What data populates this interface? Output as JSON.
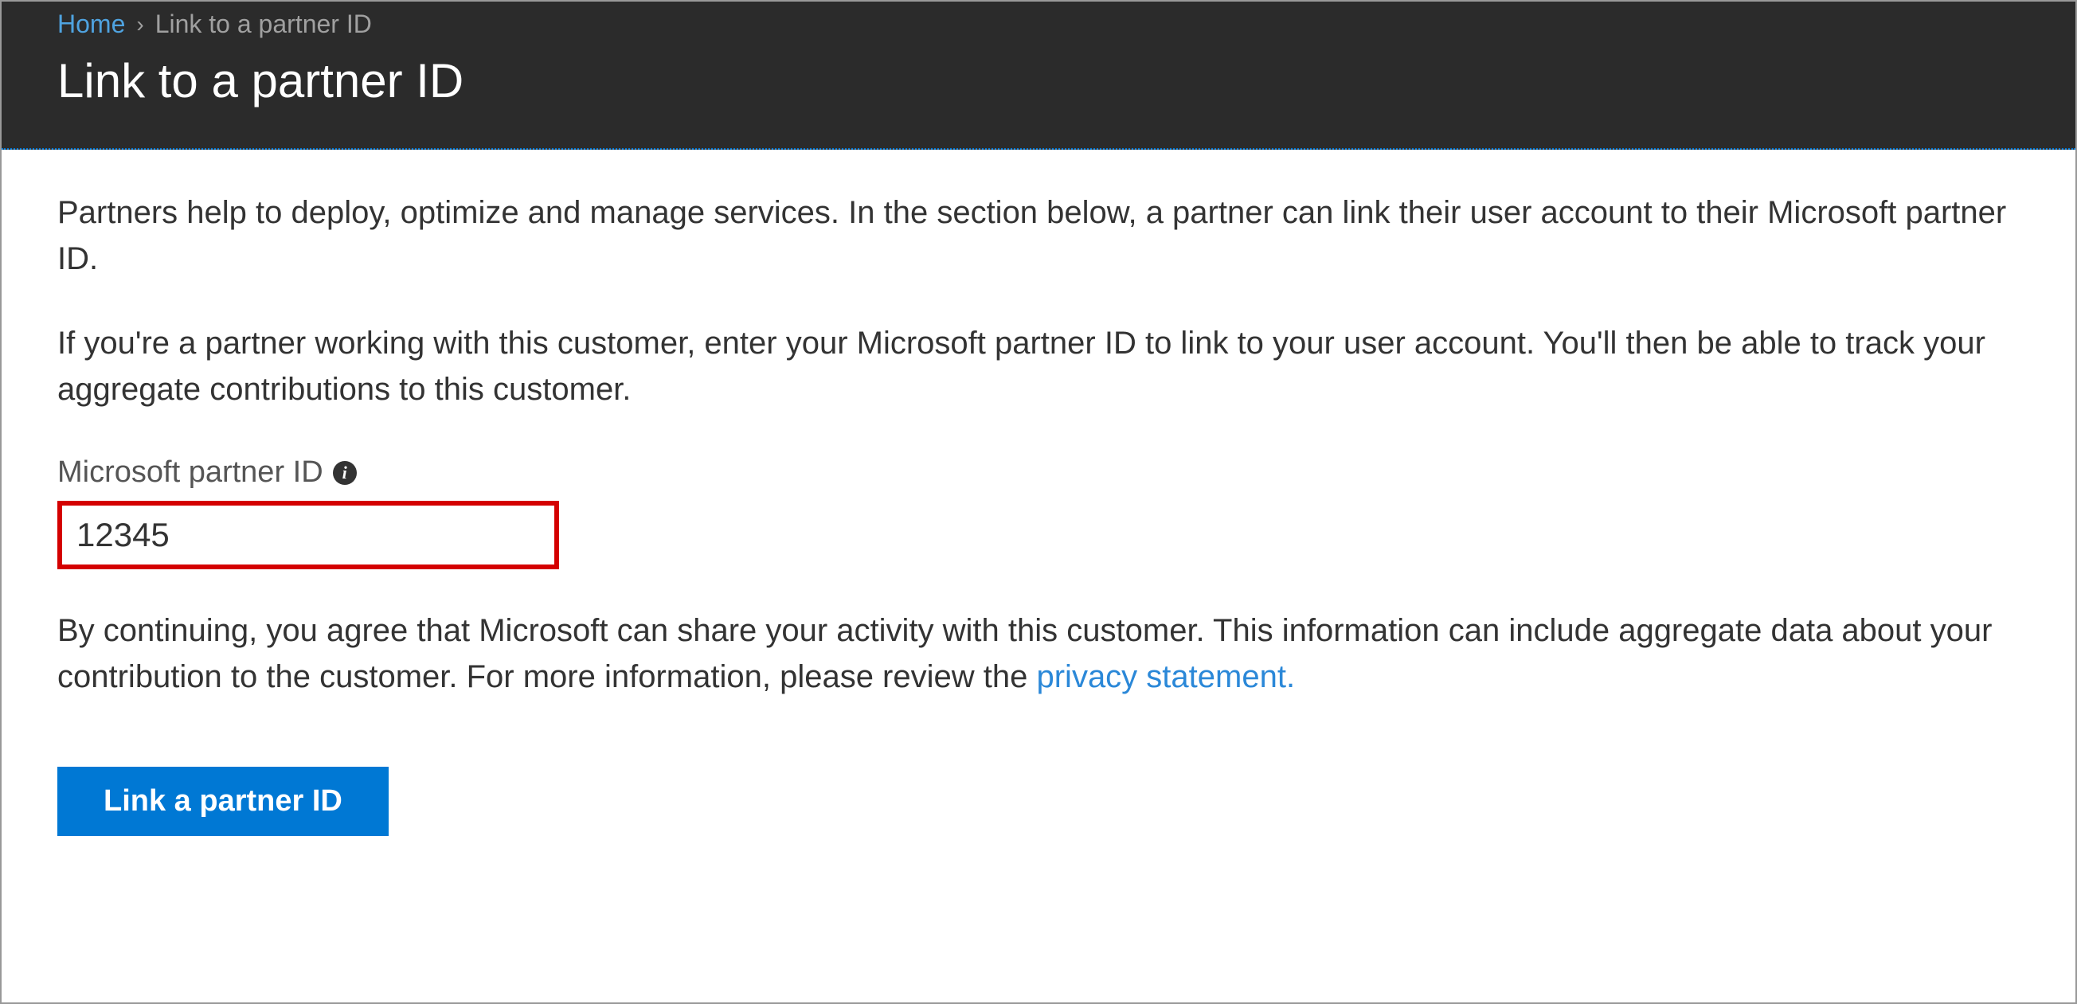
{
  "breadcrumb": {
    "home": "Home",
    "current": "Link to a partner ID"
  },
  "page_title": "Link to a partner ID",
  "content": {
    "intro_paragraph": "Partners help to deploy, optimize and manage services. In the section below, a partner can link their user account to their Microsoft partner ID.",
    "instruction_paragraph": "If you're a partner working with this customer, enter your Microsoft partner ID to link to your user account. You'll then be able to track your aggregate contributions to this customer.",
    "field_label": "Microsoft partner ID",
    "partner_id_value": "12345",
    "disclaimer_prefix": "By continuing, you agree that Microsoft can share your activity with this customer. This information can include aggregate data about your contribution to the customer. For more information, please review the ",
    "privacy_link_text": "privacy statement.",
    "button_label": "Link a partner ID"
  }
}
